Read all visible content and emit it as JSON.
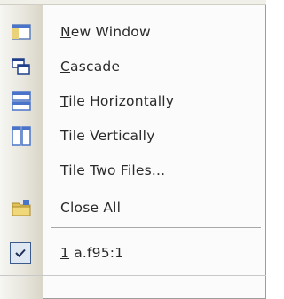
{
  "menu": {
    "items": [
      {
        "mnemonic": "N",
        "rest": "ew Window",
        "icon": "new-window-icon"
      },
      {
        "mnemonic": "C",
        "rest": "ascade",
        "icon": "cascade-icon"
      },
      {
        "mnemonic": "T",
        "rest": "ile Horizontally",
        "icon": "tile-horizontally-icon"
      },
      {
        "label": "Tile Vertically",
        "icon": "tile-vertically-icon"
      },
      {
        "label": "Tile Two Files...",
        "icon": ""
      },
      {
        "label": "Close All",
        "icon": "close-all-folder-icon"
      },
      {
        "mnemonic": "1",
        "rest": " a.f95:1",
        "icon": "checkmark-icon",
        "checked": true
      }
    ]
  },
  "colors": {
    "accent": "#3b5b8c",
    "folder": "#e2c15a",
    "window_blue": "#4a74c9"
  }
}
